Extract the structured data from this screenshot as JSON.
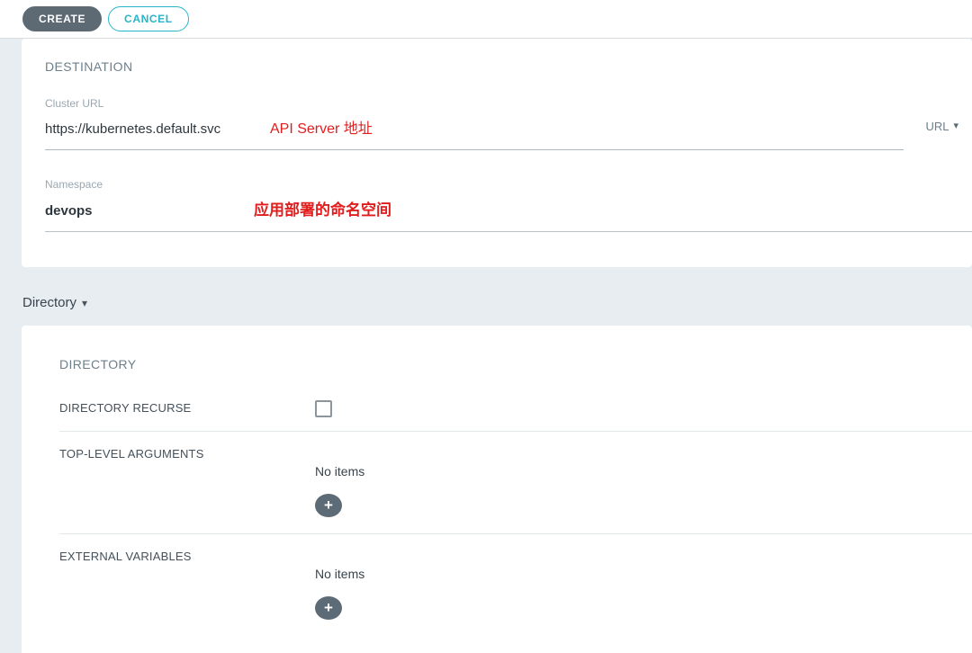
{
  "toolbar": {
    "create_label": "CREATE",
    "cancel_label": "CANCEL"
  },
  "destination_panel": {
    "heading": "DESTINATION",
    "cluster_url": {
      "label": "Cluster URL",
      "value": "https://kubernetes.default.svc",
      "annotation": "API Server 地址",
      "type_selector_value": "URL"
    },
    "namespace": {
      "label": "Namespace",
      "value": "devops",
      "annotation": "应用部署的命名空间"
    }
  },
  "source_type_selector": {
    "label": "Directory"
  },
  "directory_panel": {
    "heading": "DIRECTORY",
    "rows": [
      {
        "label": "DIRECTORY RECURSE",
        "control": "checkbox",
        "checked": false
      },
      {
        "label": "TOP-LEVEL ARGUMENTS",
        "empty_text": "No items"
      },
      {
        "label": "EXTERNAL VARIABLES",
        "empty_text": "No items"
      }
    ]
  },
  "icons": {
    "dropdown": "▾",
    "plus": "+"
  },
  "colors": {
    "accent_teal": "#29b5c8",
    "button_dark": "#5d6a74",
    "annotation_red": "#e11d1d",
    "page_background": "#e8edf1",
    "panel_background": "#ffffff",
    "heading_gray": "#6d7f8b"
  }
}
